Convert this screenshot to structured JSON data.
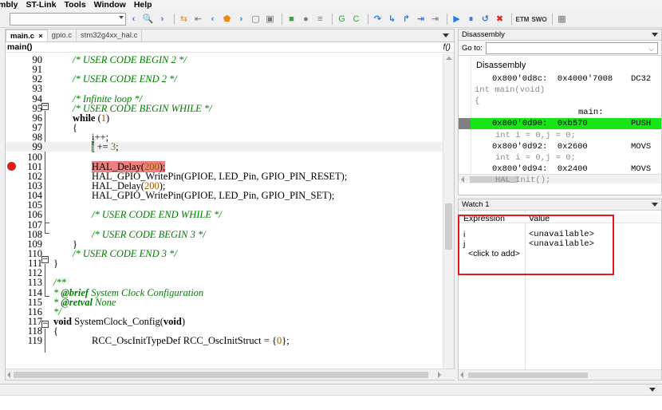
{
  "menu": [
    "mbly",
    "ST-Link",
    "Tools",
    "Window",
    "Help"
  ],
  "editor": {
    "tabs": [
      {
        "label": "main.c",
        "close": "×",
        "active": true
      },
      {
        "label": "gpio.c",
        "active": false
      },
      {
        "label": "stm32g4xx_hal.c",
        "active": false
      }
    ],
    "function": "main()",
    "function_icon": "f()",
    "lines": [
      {
        "n": "90",
        "html": "<span class='cm'>/* USER CODE BEGIN 2 */</span>",
        "indent": 2
      },
      {
        "n": "91",
        "html": "",
        "indent": 0
      },
      {
        "n": "92",
        "html": "<span class='cm'>/* USER CODE END 2 */</span>",
        "indent": 2
      },
      {
        "n": "93",
        "html": "",
        "indent": 0
      },
      {
        "n": "94",
        "html": "<span class='cm'>/* Infinite loop */</span>",
        "indent": 2
      },
      {
        "n": "95",
        "html": "<span class='cm'>/* USER CODE BEGIN WHILE */</span>",
        "indent": 2
      },
      {
        "n": "96",
        "html": "<span class='kw'>while</span> (<span class='num'>1</span>)",
        "indent": 2
      },
      {
        "n": "97",
        "html": "{",
        "indent": 2
      },
      {
        "n": "98",
        "html": "i++;",
        "indent": 4
      },
      {
        "n": "99",
        "html": "<span class='cursor-block'>j</span> += <span class='num'>3</span>;",
        "indent": 4,
        "current": true
      },
      {
        "n": "100",
        "html": "",
        "indent": 0
      },
      {
        "n": "101",
        "html": "<span class='hl'>HAL_Delay(<span class='num'>200</span>);</span>",
        "indent": 4,
        "breakpoint": true
      },
      {
        "n": "102",
        "html": "HAL_GPIO_WritePin(GPIOE, LED_Pin, GPIO_PIN_RESET);",
        "indent": 4
      },
      {
        "n": "103",
        "html": "HAL_Delay(<span class='num'>200</span>);",
        "indent": 4
      },
      {
        "n": "104",
        "html": "HAL_GPIO_WritePin(GPIOE, LED_Pin, GPIO_PIN_SET);",
        "indent": 4
      },
      {
        "n": "105",
        "html": "",
        "indent": 0
      },
      {
        "n": "106",
        "html": "<span class='cm'>/* USER CODE END WHILE */</span>",
        "indent": 4
      },
      {
        "n": "107",
        "html": "",
        "indent": 0
      },
      {
        "n": "108",
        "html": "<span class='cm'>/* USER CODE BEGIN 3 */</span>",
        "indent": 4
      },
      {
        "n": "109",
        "html": "}",
        "indent": 2
      },
      {
        "n": "110",
        "html": "<span class='cm'>/* USER CODE END 3 */</span>",
        "indent": 2
      },
      {
        "n": "111",
        "html": "}",
        "indent": 0
      },
      {
        "n": "112",
        "html": "",
        "indent": 0
      },
      {
        "n": "113",
        "html": "<span class='cm'>/**</span>",
        "indent": 0
      },
      {
        "n": "114",
        "html": "<span class='cm'>* <b>@brief</b> System Clock Configuration</span>",
        "indent": 0
      },
      {
        "n": "115",
        "html": "<span class='cm'>* <b>@retval</b> None</span>",
        "indent": 0
      },
      {
        "n": "116",
        "html": "<span class='cm'>*/</span>",
        "indent": 0
      },
      {
        "n": "117",
        "html": "<span class='kw'>void</span> SystemClock_Config(<span class='kw'>void</span>)",
        "indent": 0
      },
      {
        "n": "118",
        "html": "{",
        "indent": 0
      },
      {
        "n": "119",
        "html": "RCC_OscInitTypeDef RCC_OscInitStruct = {<span class='num'>0</span>};",
        "indent": 4
      }
    ]
  },
  "disassembly": {
    "title": "Disassembly",
    "goto_label": "Go to:",
    "goto_chevron": "⌵",
    "heading": "Disassembly",
    "lines": [
      {
        "addr": "0x800'0d8c:  0x4000'7008",
        "mn": "DC32",
        "kind": "code"
      },
      {
        "addr": "int main(void)",
        "mn": "",
        "kind": "src"
      },
      {
        "addr": "{",
        "mn": "",
        "kind": "src"
      },
      {
        "addr": "main:",
        "mn": "",
        "kind": "label"
      },
      {
        "addr": "0x800'0d90:  0xb570",
        "mn": "PUSH",
        "kind": "code",
        "current": true
      },
      {
        "addr": "int i = 0,j = 0;",
        "mn": "",
        "kind": "src-in"
      },
      {
        "addr": "0x800'0d92:  0x2600",
        "mn": "MOVS",
        "kind": "code"
      },
      {
        "addr": "int i = 0,j = 0;",
        "mn": "",
        "kind": "src-in"
      },
      {
        "addr": "0x800'0d94:  0x2400",
        "mn": "MOVS",
        "kind": "code"
      },
      {
        "addr": "HAL_Init();",
        "mn": "",
        "kind": "src-in"
      }
    ]
  },
  "watch": {
    "title": "Watch 1",
    "col_expression": "Expression",
    "col_value": "Value",
    "rows": [
      {
        "expr": "i",
        "value": "<unavailable>"
      },
      {
        "expr": "j",
        "value": "<unavailable>"
      }
    ],
    "add_hint": "<click to add>"
  },
  "toolbar": {
    "icons": [
      {
        "name": "back-icon",
        "glyph": "‹",
        "cls": "blue"
      },
      {
        "name": "search-icon",
        "glyph": "🔍",
        "cls": "gray"
      },
      {
        "name": "forward-icon",
        "glyph": "›",
        "cls": "blue"
      },
      {
        "name": "sep"
      },
      {
        "name": "toggle-bookmark-icon",
        "glyph": "⇆",
        "cls": "orange"
      },
      {
        "name": "prev-bookmark-icon",
        "glyph": "⇤",
        "cls": "gray"
      },
      {
        "name": "prev-icon",
        "glyph": "‹",
        "cls": "blue"
      },
      {
        "name": "bookmark-shield-icon",
        "glyph": "⬟",
        "cls": "orange"
      },
      {
        "name": "next-icon",
        "glyph": "›",
        "cls": "blue"
      },
      {
        "name": "page-icon",
        "glyph": "▢",
        "cls": "gray"
      },
      {
        "name": "page2-icon",
        "glyph": "▣",
        "cls": "gray"
      },
      {
        "name": "sep"
      },
      {
        "name": "build-icon",
        "glyph": "■",
        "cls": "green"
      },
      {
        "name": "make-icon",
        "glyph": "●",
        "cls": "gray"
      },
      {
        "name": "options-icon",
        "glyph": "≡",
        "cls": "gray"
      },
      {
        "name": "sep"
      },
      {
        "name": "go-icon",
        "glyph": "G",
        "cls": "green"
      },
      {
        "name": "reset-icon",
        "glyph": "C",
        "cls": "green"
      },
      {
        "name": "sep"
      },
      {
        "name": "step-over-icon",
        "glyph": "↷",
        "cls": "blue"
      },
      {
        "name": "step-into-icon",
        "glyph": "↳",
        "cls": "blue"
      },
      {
        "name": "step-out-icon",
        "glyph": "↱",
        "cls": "blue"
      },
      {
        "name": "next-statement-icon",
        "glyph": "⇥",
        "cls": "blue"
      },
      {
        "name": "run-to-cursor-icon",
        "glyph": "⇥",
        "cls": "gray"
      },
      {
        "name": "sep"
      },
      {
        "name": "run-icon",
        "glyph": "▶",
        "cls": "blue"
      },
      {
        "name": "break-icon",
        "glyph": "⏸",
        "cls": "blue"
      },
      {
        "name": "restart-icon",
        "glyph": "↺",
        "cls": "blue"
      },
      {
        "name": "stop-icon",
        "glyph": "✖",
        "cls": "red"
      },
      {
        "name": "sep"
      },
      {
        "name": "etm-icon",
        "glyph": "ETM",
        "cls": "small"
      },
      {
        "name": "swo-icon",
        "glyph": "SWO",
        "cls": "small"
      },
      {
        "name": "sep"
      },
      {
        "name": "chip-icon",
        "glyph": "▦",
        "cls": "gray"
      }
    ]
  }
}
